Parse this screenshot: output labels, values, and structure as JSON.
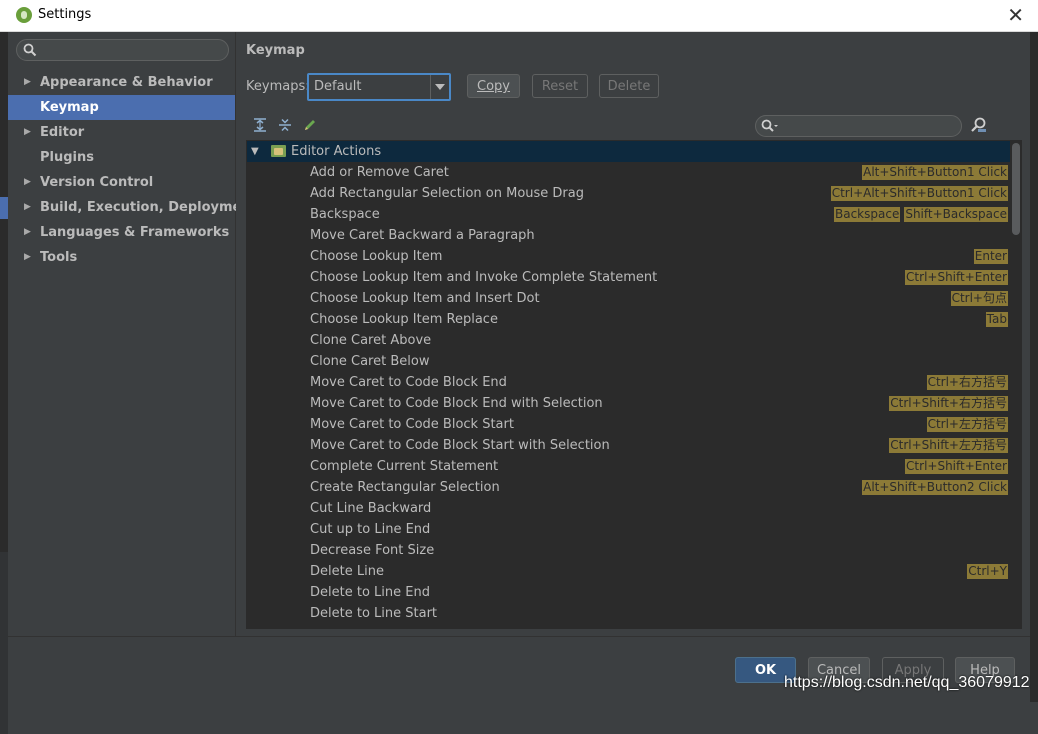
{
  "window": {
    "title": "Settings",
    "close_glyph": "✕",
    "icon": "android-studio-icon"
  },
  "sidebar": {
    "search_placeholder": "",
    "items": [
      {
        "label": "Appearance & Behavior",
        "expandable": true
      },
      {
        "label": "Keymap",
        "expandable": false,
        "selected": true
      },
      {
        "label": "Editor",
        "expandable": true
      },
      {
        "label": "Plugins",
        "expandable": false
      },
      {
        "label": "Version Control",
        "expandable": true
      },
      {
        "label": "Build, Execution, Deployment",
        "expandable": true
      },
      {
        "label": "Languages & Frameworks",
        "expandable": true
      },
      {
        "label": "Tools",
        "expandable": true
      }
    ]
  },
  "main": {
    "heading": "Keymap",
    "keymaps_label": "Keymaps:",
    "keymaps_value": "Default",
    "buttons": {
      "copy": "Copy",
      "reset": "Reset",
      "delete": "Delete"
    },
    "toolbar_icons": [
      "expand-all-icon",
      "collapse-all-icon",
      "edit-icon"
    ],
    "filter_placeholder": "",
    "tree": {
      "group": "Editor Actions",
      "actions": [
        {
          "name": "Add or Remove Caret",
          "shortcuts": [
            "Alt+Shift+Button1 Click"
          ]
        },
        {
          "name": "Add Rectangular Selection on Mouse Drag",
          "shortcuts": [
            "Ctrl+Alt+Shift+Button1 Click"
          ]
        },
        {
          "name": "Backspace",
          "shortcuts": [
            "Backspace",
            "Shift+Backspace"
          ]
        },
        {
          "name": "Move Caret Backward a Paragraph",
          "shortcuts": []
        },
        {
          "name": "Choose Lookup Item",
          "shortcuts": [
            "Enter"
          ]
        },
        {
          "name": "Choose Lookup Item and Invoke Complete Statement",
          "shortcuts": [
            "Ctrl+Shift+Enter"
          ]
        },
        {
          "name": "Choose Lookup Item and Insert Dot",
          "shortcuts": [
            "Ctrl+句点"
          ]
        },
        {
          "name": "Choose Lookup Item Replace",
          "shortcuts": [
            "Tab"
          ]
        },
        {
          "name": "Clone Caret Above",
          "shortcuts": []
        },
        {
          "name": "Clone Caret Below",
          "shortcuts": []
        },
        {
          "name": "Move Caret to Code Block End",
          "shortcuts": [
            "Ctrl+右方括号"
          ]
        },
        {
          "name": "Move Caret to Code Block End with Selection",
          "shortcuts": [
            "Ctrl+Shift+右方括号"
          ]
        },
        {
          "name": "Move Caret to Code Block Start",
          "shortcuts": [
            "Ctrl+左方括号"
          ]
        },
        {
          "name": "Move Caret to Code Block Start with Selection",
          "shortcuts": [
            "Ctrl+Shift+左方括号"
          ]
        },
        {
          "name": "Complete Current Statement",
          "shortcuts": [
            "Ctrl+Shift+Enter"
          ]
        },
        {
          "name": "Create Rectangular Selection",
          "shortcuts": [
            "Alt+Shift+Button2 Click"
          ]
        },
        {
          "name": "Cut Line Backward",
          "shortcuts": []
        },
        {
          "name": "Cut up to Line End",
          "shortcuts": []
        },
        {
          "name": "Decrease Font Size",
          "shortcuts": []
        },
        {
          "name": "Delete Line",
          "shortcuts": [
            "Ctrl+Y"
          ]
        },
        {
          "name": "Delete to Line End",
          "shortcuts": []
        },
        {
          "name": "Delete to Line Start",
          "shortcuts": []
        }
      ]
    }
  },
  "footer": {
    "ok": "OK",
    "cancel": "Cancel",
    "apply": "Apply",
    "help": "Help"
  },
  "watermark": "https://blog.csdn.net/qq_36079912",
  "colors": {
    "background": "#3c3f41",
    "selection": "#4b6eaf",
    "shortcut_badge": "#8c7a37",
    "tree_bg": "#2b2b2b"
  }
}
